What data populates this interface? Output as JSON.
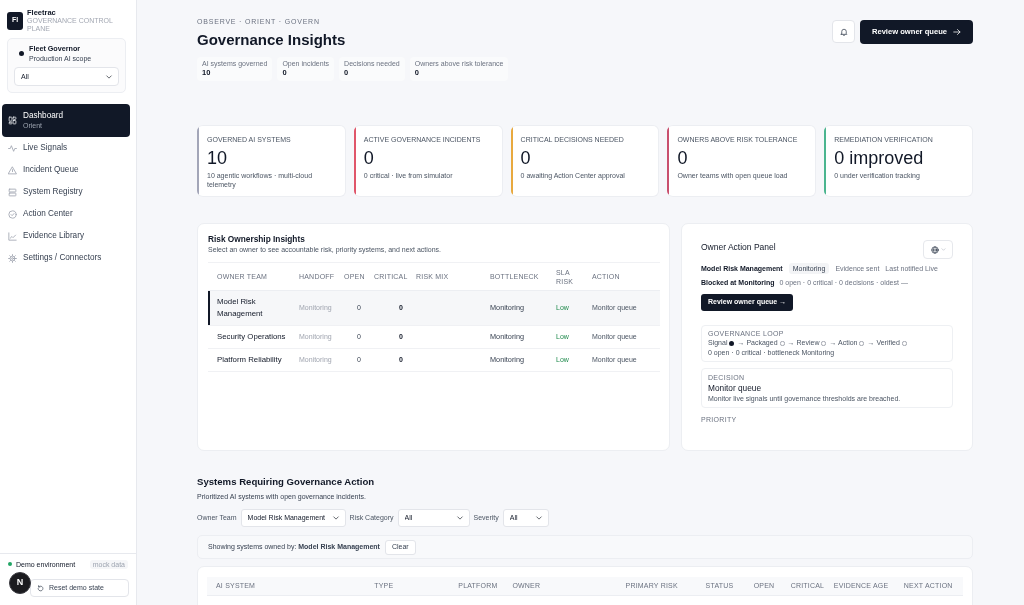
{
  "sidebar": {
    "brand": {
      "logo": "Fl",
      "name": "Fleetrac",
      "tagline": "GOVERNANCE CONTROL PLANE"
    },
    "scope": {
      "name": "Fleet Governor",
      "description": "Production AI scope",
      "select": "All"
    },
    "nav": [
      {
        "label": "Dashboard",
        "sub": "Orient",
        "selected": true
      },
      {
        "label": "Live Signals",
        "selected": false
      },
      {
        "label": "Incident Queue",
        "selected": false
      },
      {
        "label": "System Registry",
        "selected": false
      },
      {
        "label": "Action Center",
        "selected": false
      },
      {
        "label": "Evidence Library",
        "selected": false
      },
      {
        "label": "Settings / Connectors",
        "selected": false
      }
    ],
    "footer": {
      "environment": "Demo environment",
      "badge": "mock data",
      "reset_button": "Reset demo state"
    }
  },
  "dev_badge": "N",
  "header": {
    "eyebrow": "OBSERVE · ORIENT · GOVERN",
    "title": "Governance Insights",
    "stats": [
      {
        "label": "AI systems governed",
        "value": "10"
      },
      {
        "label": "Open incidents",
        "value": "0"
      },
      {
        "label": "Decisions needed",
        "value": "0"
      },
      {
        "label": "Owners above risk tolerance",
        "value": "0"
      }
    ],
    "primary_button": "Review owner queue"
  },
  "kpis": [
    {
      "label": "GOVERNED AI SYSTEMS",
      "value": "10",
      "detail": "10 agentic workflows · multi-cloud telemetry",
      "color": "#a3a6b8"
    },
    {
      "label": "ACTIVE GOVERNANCE INCIDENTS",
      "value": "0",
      "detail": "0 critical · live from simulator",
      "color": "#e0566a"
    },
    {
      "label": "CRITICAL DECISIONS NEEDED",
      "value": "0",
      "detail": "0 awaiting Action Center approval",
      "color": "#e8a93e"
    },
    {
      "label": "OWNERS ABOVE RISK TOLERANCE",
      "value": "0",
      "detail": "Owner teams with open queue load",
      "color": "#c9506e"
    },
    {
      "label": "REMEDIATION VERIFICATION",
      "value": "0 improved",
      "detail": "0 under verification tracking",
      "color": "#4bb58f"
    }
  ],
  "risk_ownership": {
    "title": "Risk Ownership Insights",
    "subtitle": "Select an owner to see accountable risk, priority systems, and next actions.",
    "columns": [
      "OWNER TEAM",
      "HANDOFF",
      "OPEN",
      "CRITICAL",
      "RISK MIX",
      "BOTTLENECK",
      "SLA RISK",
      "ACTION"
    ],
    "rows": [
      {
        "owner_team": "Model Risk Management",
        "handoff": "Monitoring",
        "open": "0",
        "critical": "0",
        "bottleneck": "Monitoring",
        "sla_risk": "Low",
        "action": "Monitor queue",
        "selected": true
      },
      {
        "owner_team": "Security Operations",
        "handoff": "Monitoring",
        "open": "0",
        "critical": "0",
        "bottleneck": "Monitoring",
        "sla_risk": "Low",
        "action": "Monitor queue",
        "selected": false
      },
      {
        "owner_team": "Platform Reliability",
        "handoff": "Monitoring",
        "open": "0",
        "critical": "0",
        "bottleneck": "Monitoring",
        "sla_risk": "Low",
        "action": "Monitor queue",
        "selected": false
      }
    ]
  },
  "owner_panel": {
    "title": "Owner Action Panel",
    "owner": "Model Risk Management",
    "status": "Monitoring",
    "evidence": "Evidence sent",
    "last_notified": "Last notified Live",
    "blocked": "Blocked at Monitoring",
    "blocked_summary": "0 open · 0 critical · 0 decisions · oldest —",
    "button": "Review owner queue →",
    "loop": {
      "label": "GOVERNANCE LOOP",
      "steps": [
        {
          "label": "Signal",
          "done": true
        },
        {
          "label": "→ Packaged",
          "done": false
        },
        {
          "label": "→ Review",
          "done": false
        },
        {
          "label": "→ Action",
          "done": false
        },
        {
          "label": "→ Verified",
          "done": false
        }
      ],
      "summary": "0 open · 0 critical · bottleneck Monitoring"
    },
    "decision": {
      "label": "DECISION",
      "title": "Monitor queue",
      "text": "Monitor live signals until governance thresholds are breached."
    },
    "priority_label": "PRIORITY"
  },
  "systems": {
    "title": "Systems Requiring Governance Action",
    "subtitle": "Prioritized AI systems with open governance incidents.",
    "filters": [
      {
        "label": "Owner Team",
        "value": "Model Risk Management"
      },
      {
        "label": "Risk Category",
        "value": "All"
      },
      {
        "label": "Severity",
        "value": "All"
      }
    ],
    "active_filter": "Showing systems owned by: **Model Risk Management**",
    "clear_button": "Clear",
    "columns": [
      "AI SYSTEM",
      "TYPE",
      "PLATFORM",
      "OWNER",
      "PRIMARY RISK",
      "STATUS",
      "OPEN",
      "CRITICAL",
      "EVIDENCE AGE",
      "NEXT ACTION"
    ]
  }
}
